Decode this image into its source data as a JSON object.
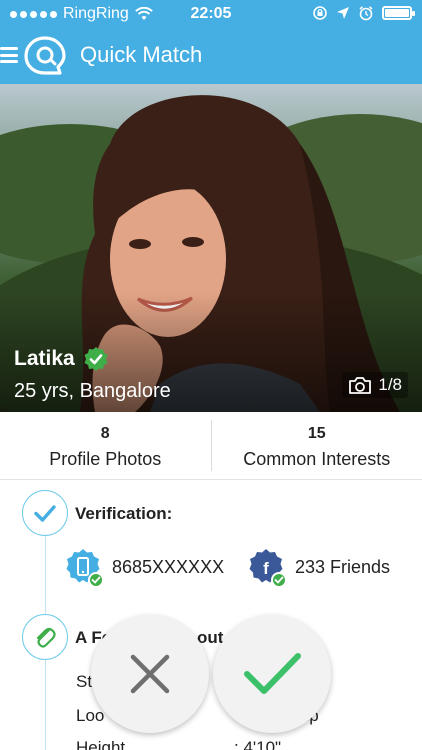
{
  "status_bar": {
    "carrier": "RingRing",
    "time": "22:05"
  },
  "header": {
    "title": "Quick Match"
  },
  "profile": {
    "name": "Latika",
    "sub_info": "25 yrs, Bangalore",
    "photo_counter": "1/8",
    "verified": true
  },
  "stats": [
    {
      "value": "8",
      "label": "Profile Photos"
    },
    {
      "value": "15",
      "label": "Common Interests"
    }
  ],
  "verification": {
    "title": "Verification:",
    "phone": "8685XXXXXX",
    "facebook": "233 Friends"
  },
  "about": {
    "title": "A Fe",
    "title_tail": "out",
    "rows": [
      {
        "label": "St",
        "value": ""
      },
      {
        "label": "Loo",
        "value": "hip"
      },
      {
        "label": "Height",
        "value": ": 4'10\""
      }
    ]
  },
  "actions": {
    "reject_label": "reject",
    "accept_label": "accept"
  },
  "colors": {
    "brand_blue": "#45aee2",
    "verified_green": "#3fae49",
    "facebook_blue": "#3b5998",
    "accept_green": "#3cc06a",
    "reject_gray": "#6f6f6f"
  }
}
